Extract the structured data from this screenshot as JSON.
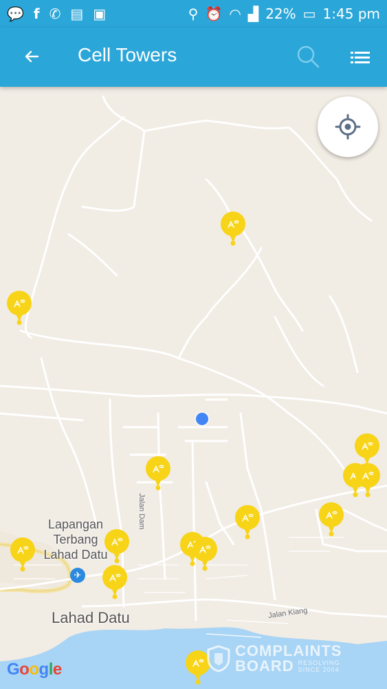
{
  "status_bar": {
    "battery_percent": "22%",
    "time": "1:45 pm",
    "icons": [
      "message-icon",
      "facebook-icon",
      "whatsapp-icon",
      "chat-icon",
      "gallery-icon",
      "location-icon",
      "alarm-icon",
      "wifi-icon",
      "signal-icon",
      "battery-icon"
    ]
  },
  "app_bar": {
    "title": "Cell Towers",
    "color": "#2ba6d8",
    "icons": [
      "back-arrow-icon",
      "search-icon",
      "list-icon"
    ]
  },
  "map": {
    "labels": {
      "airport": "Lapangan\nTerbang\nLahad Datu",
      "town": "Lahad Datu",
      "street_dam": "Jalan Dam",
      "street_kiang": "Jalan Kiang"
    },
    "attribution": "Google",
    "marker_color": "#f7d417",
    "user_location_color": "#4285f4",
    "tower_marker_icon": "cell-tower-marker-icon"
  },
  "watermark": {
    "line1": "COMPLAINTS",
    "line2": "BOARD",
    "sub1": "RESOLVING",
    "sub2": "SINCE 2004"
  }
}
